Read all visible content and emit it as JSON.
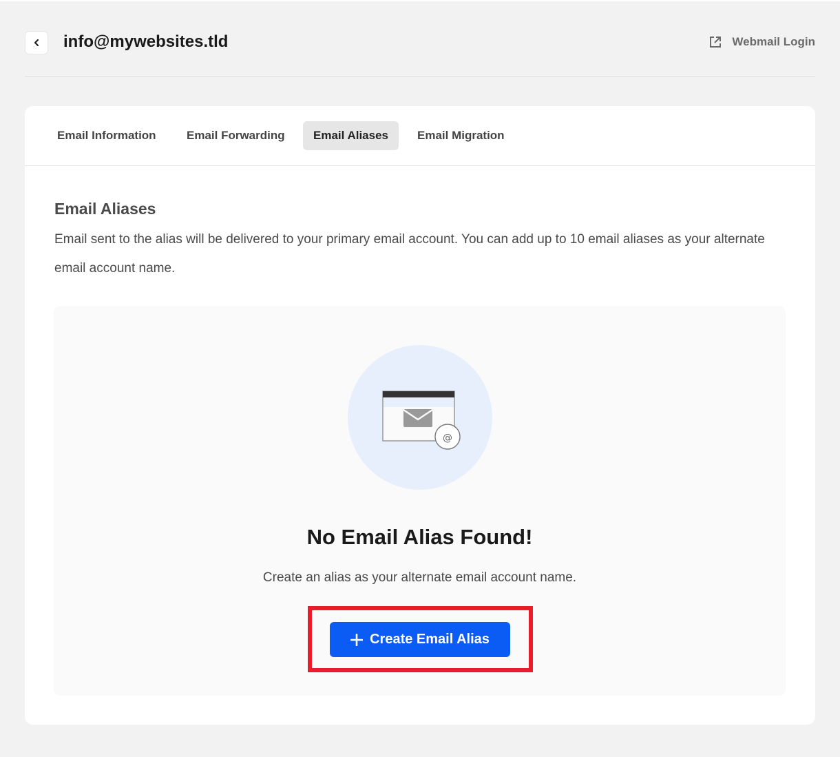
{
  "header": {
    "title": "info@mywebsites.tld",
    "back_icon": "chevron-left-icon",
    "webmail_label": "Webmail Login",
    "webmail_icon": "external-link-icon"
  },
  "tabs": [
    {
      "label": "Email Information",
      "active": false
    },
    {
      "label": "Email Forwarding",
      "active": false
    },
    {
      "label": "Email Aliases",
      "active": true
    },
    {
      "label": "Email Migration",
      "active": false
    }
  ],
  "section": {
    "title": "Email Aliases",
    "description": "Email sent to the alias will be delivered to your primary email account. You can add up to 10 email aliases as your alternate email account name."
  },
  "empty_state": {
    "illustration": "email-alias-illustration",
    "title": "No Email Alias Found!",
    "description": "Create an alias as your alternate email account name.",
    "button_label": "Create Email Alias",
    "button_icon": "plus-icon"
  },
  "colors": {
    "accent": "#0a5cf5",
    "highlight": "#e81c2a",
    "background": "#f2f2f2"
  }
}
